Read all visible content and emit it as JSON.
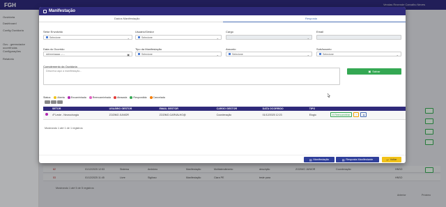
{
  "app": {
    "logo": "FGH",
    "user": "Vendas Rezende Carvalho Neves"
  },
  "sidebar": {
    "items": [
      {
        "label": "Ouvidoria"
      },
      {
        "label": "Dashboard"
      },
      {
        "label": "Config Ouvidoria"
      },
      {
        "label": "Ouv - gerenciador ocorrências"
      },
      {
        "label": "Configurações"
      },
      {
        "label": "Relatório"
      }
    ]
  },
  "background": {
    "rows": [
      {
        "num": "82",
        "date": "01/12/2025 12:53",
        "origem": "Sistema",
        "anon": "Anônimo",
        "tipo": "Manifestação",
        "setor": "Multiatendimento",
        "desc": "descrição",
        "gestor": "ZOZIMO JUNIOR",
        "cargo": "Coordenação",
        "code": "HNSO"
      },
      {
        "num": "53",
        "date": "01/12/2025 11:45",
        "origem": "Livre",
        "anon": "Sigiloso",
        "tipo": "Manifestação",
        "setor": "Clara PE",
        "desc": "teste para",
        "gestor": "",
        "cargo": "",
        "code": "HNSO"
      }
    ],
    "records": "Mostrando 1 até 5 de 5 registros",
    "pager": {
      "prev": "Anterior",
      "next": "Próximo"
    }
  },
  "modal": {
    "title": "Manifestação",
    "tabs": [
      "Dados Manifestação",
      "Resposta"
    ],
    "fields": {
      "setor_envolvido": {
        "label": "Setor Envolvido",
        "value": "Selecione"
      },
      "usuario_gestor": {
        "label": "Usuário/Gestor",
        "value": "Selecione"
      },
      "cargo": {
        "label": "Cargo",
        "value": ""
      },
      "email": {
        "label": "Email",
        "value": ""
      },
      "data_ocorrido": {
        "label": "Data do Ocorrido",
        "value": "dd/mm/aaaa --:--"
      },
      "tipo_manifestacao": {
        "label": "Tipo da Manifestação",
        "value": "Selecione"
      },
      "assunto": {
        "label": "Assunto",
        "value": "Selecione"
      },
      "subassunto": {
        "label": "SubAssunto",
        "value": "Selecione"
      },
      "complemento": {
        "label": "Complemento da Ouvidoria",
        "placeholder": "Descreva aqui a manifestação..."
      }
    },
    "save_label": "Salvar",
    "status": {
      "label": "Status:",
      "items": [
        {
          "label": "Aberta",
          "color": "#f0c419"
        },
        {
          "label": "Encaminhada",
          "color": "#b028b0"
        },
        {
          "label": "Reencaminhada",
          "color": "#e060c0"
        },
        {
          "label": "Atrasada",
          "color": "#e53935"
        },
        {
          "label": "Respondida",
          "color": "#34a853"
        },
        {
          "label": "Cancelada",
          "color": "#f57c00"
        }
      ]
    },
    "table": {
      "headers": [
        "SETOR",
        "USUÁRIO GESTOR",
        "EMAIL GESTOR",
        "CARGO GESTOR",
        "DATA OCORRIDO",
        "TIPO",
        ""
      ],
      "rows": [
        {
          "setor": "4º Leste - Neurocirurgia",
          "usuario": "ZOZIMO JUNIOR",
          "email": "ZOZIMO.CARVALHO@",
          "cargo": "Coordenação",
          "data": "01/12/2025 12:23",
          "tipo": "Elogio",
          "action": "Reencaminhar"
        }
      ]
    },
    "records": "Mostrando 1 até 1 de 1 registros",
    "footer": {
      "manifestacao": "Manifestação",
      "resposta": "Resposta Manifestante",
      "voltar": "Voltar"
    }
  }
}
